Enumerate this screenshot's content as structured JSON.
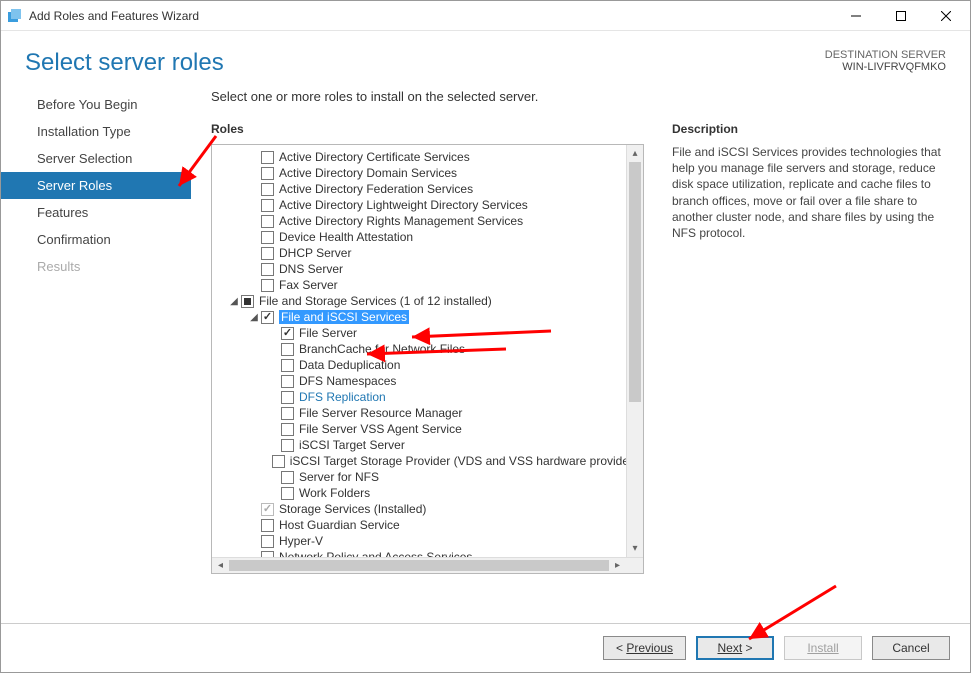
{
  "window": {
    "title": "Add Roles and Features Wizard"
  },
  "page": {
    "title": "Select server roles"
  },
  "destination": {
    "label": "DESTINATION SERVER",
    "server": "WIN-LIVFRVQFMKO"
  },
  "nav": {
    "items": [
      {
        "label": "Before You Begin",
        "state": "normal"
      },
      {
        "label": "Installation Type",
        "state": "normal"
      },
      {
        "label": "Server Selection",
        "state": "normal"
      },
      {
        "label": "Server Roles",
        "state": "active"
      },
      {
        "label": "Features",
        "state": "normal"
      },
      {
        "label": "Confirmation",
        "state": "normal"
      },
      {
        "label": "Results",
        "state": "disabled"
      }
    ]
  },
  "instruction": "Select one or more roles to install on the selected server.",
  "columns": {
    "roles_heading": "Roles",
    "description_heading": "Description"
  },
  "description": "File and iSCSI Services provides technologies that help you manage file servers and storage, reduce disk space utilization, replicate and cache files to branch offices, move or fail over a file share to another cluster node, and share files by using the NFS protocol.",
  "tree": [
    {
      "indent": 1,
      "checkbox": "unchecked",
      "label": "Active Directory Certificate Services"
    },
    {
      "indent": 1,
      "checkbox": "unchecked",
      "label": "Active Directory Domain Services"
    },
    {
      "indent": 1,
      "checkbox": "unchecked",
      "label": "Active Directory Federation Services"
    },
    {
      "indent": 1,
      "checkbox": "unchecked",
      "label": "Active Directory Lightweight Directory Services"
    },
    {
      "indent": 1,
      "checkbox": "unchecked",
      "label": "Active Directory Rights Management Services"
    },
    {
      "indent": 1,
      "checkbox": "unchecked",
      "label": "Device Health Attestation"
    },
    {
      "indent": 1,
      "checkbox": "unchecked",
      "label": "DHCP Server"
    },
    {
      "indent": 1,
      "checkbox": "unchecked",
      "label": "DNS Server"
    },
    {
      "indent": 1,
      "checkbox": "unchecked",
      "label": "Fax Server"
    },
    {
      "indent": 0,
      "expander": "open",
      "checkbox": "indeterminate",
      "label": "File and Storage Services (1 of 12 installed)"
    },
    {
      "indent": 1,
      "expander": "open",
      "checkbox": "checked",
      "label": "File and iSCSI Services",
      "highlight": true
    },
    {
      "indent": 2,
      "checkbox": "checked",
      "label": "File Server"
    },
    {
      "indent": 2,
      "checkbox": "unchecked",
      "label": "BranchCache for Network Files"
    },
    {
      "indent": 2,
      "checkbox": "unchecked",
      "label": "Data Deduplication"
    },
    {
      "indent": 2,
      "checkbox": "unchecked",
      "label": "DFS Namespaces"
    },
    {
      "indent": 2,
      "checkbox": "unchecked",
      "label": "DFS Replication",
      "link": true
    },
    {
      "indent": 2,
      "checkbox": "unchecked",
      "label": "File Server Resource Manager"
    },
    {
      "indent": 2,
      "checkbox": "unchecked",
      "label": "File Server VSS Agent Service"
    },
    {
      "indent": 2,
      "checkbox": "unchecked",
      "label": "iSCSI Target Server"
    },
    {
      "indent": 2,
      "checkbox": "unchecked",
      "label": "iSCSI Target Storage Provider (VDS and VSS hardware providers)"
    },
    {
      "indent": 2,
      "checkbox": "unchecked",
      "label": "Server for NFS"
    },
    {
      "indent": 2,
      "checkbox": "unchecked",
      "label": "Work Folders"
    },
    {
      "indent": 1,
      "checkbox": "checked-disabled",
      "label": "Storage Services (Installed)"
    },
    {
      "indent": 1,
      "checkbox": "unchecked",
      "label": "Host Guardian Service"
    },
    {
      "indent": 1,
      "checkbox": "unchecked",
      "label": "Hyper-V"
    },
    {
      "indent": 1,
      "checkbox": "unchecked",
      "label": "Network Policy and Access Services"
    }
  ],
  "buttons": {
    "previous": "Previous",
    "next": "Next",
    "install": "Install",
    "cancel": "Cancel"
  }
}
